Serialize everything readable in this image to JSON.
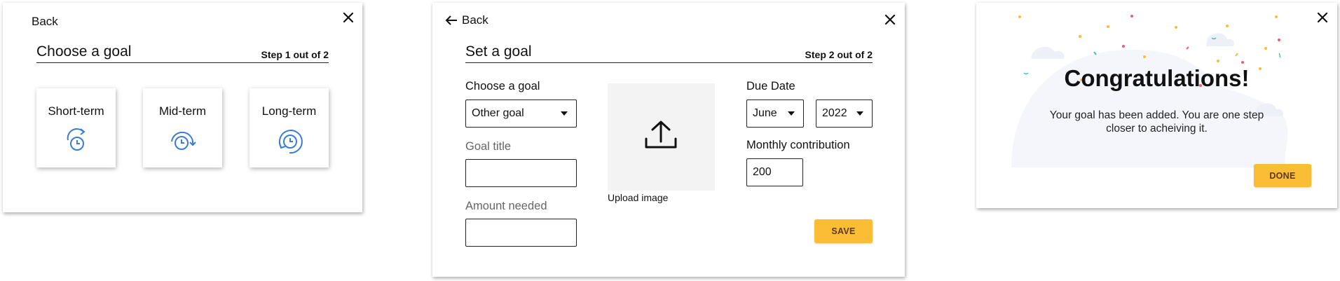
{
  "panel1": {
    "back_label": "Back",
    "title": "Choose a goal",
    "step": "Step 1 out of 2",
    "goals": [
      {
        "label": "Short-term",
        "icon": "clock-arrow-cw-icon"
      },
      {
        "label": "Mid-term",
        "icon": "clock-arrow-around-icon"
      },
      {
        "label": "Long-term",
        "icon": "clock-arrow-full-icon"
      }
    ]
  },
  "panel2": {
    "back_label": "Back",
    "title": "Set a goal",
    "step": "Step 2 out of 2",
    "choose_goal_label": "Choose a goal",
    "choose_goal_value": "Other goal",
    "goal_title_label": "Goal title",
    "goal_title_value": "",
    "amount_label": "Amount needed",
    "amount_value": "",
    "upload_label": "Upload image",
    "due_date_label": "Due Date",
    "due_month": "June",
    "due_year": "2022",
    "monthly_label": "Monthly contribution",
    "monthly_value": "200",
    "save_label": "SAVE"
  },
  "panel3": {
    "title": "Congratulations!",
    "message_line1": "Your goal has been added. You are one step",
    "message_line2": "closer to acheiving it.",
    "done_label": "DONE"
  },
  "colors": {
    "accent_blue": "#3a7bd5",
    "button_yellow": "#fbbd36",
    "upload_bg": "#f3f3f3"
  }
}
